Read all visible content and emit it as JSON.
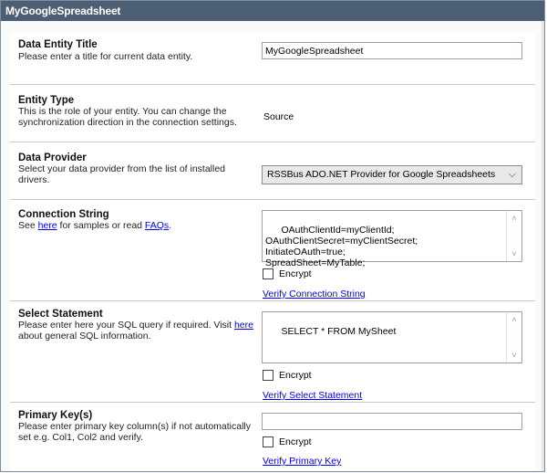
{
  "header": {
    "title": "MyGoogleSpreadsheet"
  },
  "sections": {
    "title": {
      "heading": "Data Entity Title",
      "description": "Please enter a title for current data entity.",
      "value": "MyGoogleSpreadsheet"
    },
    "type": {
      "heading": "Entity Type",
      "description": "This is the role of your entity. You can change the synchronization direction in the connection settings.",
      "value": "Source"
    },
    "provider": {
      "heading": "Data Provider",
      "description": "Select your data provider from the list of installed drivers.",
      "value": "RSSBus ADO.NET Provider for Google Spreadsheets"
    },
    "connection": {
      "heading": "Connection String",
      "desc_prefix": "See ",
      "link_here": "here",
      "desc_middle": " for samples or read ",
      "link_faqs": "FAQs",
      "desc_suffix": ".",
      "value": "OAuthClientId=myClientId;\nOAuthClientSecret=myClientSecret;\nInitiateOAuth=true;\nSpreadSheet=MyTable;",
      "encrypt_label": "Encrypt",
      "verify_label": "Verify Connection String"
    },
    "select": {
      "heading": "Select Statement",
      "desc_prefix": "Please enter here your SQL query if required. Visit ",
      "link_here": "here",
      "desc_suffix": " about general SQL information.",
      "value": "SELECT * FROM MySheet",
      "encrypt_label": "Encrypt",
      "verify_label": "Verify Select Statement"
    },
    "primary": {
      "heading": "Primary Key(s)",
      "description": "Please enter primary key column(s) if not automatically set e.g. Col1, Col2 and verify.",
      "value": "",
      "encrypt_label": "Encrypt",
      "verify_label": "Verify Primary Key"
    }
  }
}
